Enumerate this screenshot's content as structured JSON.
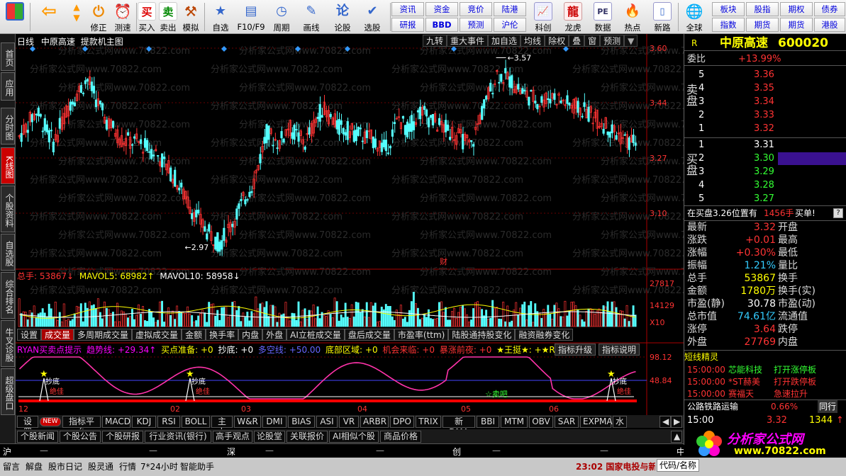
{
  "toolbar": {
    "buttons": [
      {
        "label": "",
        "icon": "grid-icon"
      },
      {
        "label": "",
        "icon": "back-arrow-icon"
      },
      {
        "label": "修正",
        "icon": "up-arrow-icon"
      },
      {
        "label": "测速",
        "icon": "power-icon"
      },
      {
        "label": "",
        "icon": "clock-icon"
      },
      {
        "label": "买入",
        "glyph": "买"
      },
      {
        "label": "卖出",
        "glyph": "卖"
      },
      {
        "label": "模拟",
        "icon": "gavel-icon"
      },
      {
        "label": "自选",
        "icon": "star-folder-icon"
      },
      {
        "label": "F10/F9",
        "icon": "window-icon"
      },
      {
        "label": "周期",
        "icon": "clock-cycle-icon"
      },
      {
        "label": "画线",
        "icon": "pencil-icon"
      },
      {
        "label": "论股",
        "glyph": "论"
      },
      {
        "label": "选股",
        "icon": "check-icon"
      },
      {
        "label": "科创",
        "icon": "chart-icon"
      },
      {
        "label": "龙虎",
        "icon": "dragon-icon"
      },
      {
        "label": "数据",
        "glyph": "PE"
      },
      {
        "label": "热点",
        "icon": "fire-icon"
      },
      {
        "label": "新路",
        "icon": "doc-icon"
      },
      {
        "label": "全球",
        "icon": "globe-icon"
      }
    ],
    "small": [
      "资讯",
      "研报",
      "资金",
      "BBD",
      "竞价",
      "预测",
      "陆港",
      "沪伦",
      "板块",
      "指数",
      "股指",
      "期货",
      "期权",
      "期货",
      "债券",
      "港股"
    ]
  },
  "lefttabs": [
    "首页",
    "应用",
    "分时图",
    "K线图",
    "个股资料",
    "自选股",
    "综合排名",
    "牛叉诊股",
    "超级盘口"
  ],
  "chart": {
    "header": {
      "period": "日线",
      "stock": "中原高速",
      "formula": "提款机主图"
    },
    "tools": [
      "九转",
      "重大事件",
      "加自选",
      "均线",
      "除权",
      "叠",
      "窗",
      "预测"
    ],
    "price_axis": [
      "3.60",
      "3.44",
      "3.27",
      "3.10"
    ],
    "watermark": "分析家公式网www.70822.com",
    "high_label": "3.57",
    "low_label": "2.97",
    "event_label": "财",
    "vol_legend": {
      "total": "总手: 53867↓",
      "ma5": "MAVOL5: 68982↑",
      "ma10": "MAVOL10: 58958↓"
    },
    "vol_axis": [
      "27817",
      "14129",
      "X10"
    ],
    "vol_tabs": [
      "设置",
      "成交量",
      "多周期成交量",
      "虚拟成交量",
      "金额",
      "换手率",
      "内盘",
      "外盘",
      "AI立桩成交量",
      "盘后成交量",
      "市盈率(ttm)",
      "陆股通持股变化",
      "融资融券变化"
    ],
    "ind_legend": {
      "a": "RYAN买卖点提示",
      "b": "趋势线: +29.34↑",
      "c": "买点准备: +0",
      "d": "抄底: +0",
      "e": "多空线: +50.00",
      "f": "底部区域: +0",
      "g": "机会来临: +0",
      "h": "暴涨前夜: +0",
      "i": "★王挺★: +★Ryan★"
    },
    "ind_buttons": [
      "指标升级",
      "指标说明"
    ],
    "ind_axis": [
      "98.12",
      "48.84"
    ],
    "sell_label": "☆卖吧",
    "bottom_labels": [
      "抄底",
      "绝佳",
      "抄底",
      "绝佳",
      "抄底",
      "绝佳"
    ],
    "months": [
      "12",
      "02",
      "03",
      "04",
      "05",
      "06"
    ]
  },
  "indicator_tabs": [
    "设置",
    "NEW",
    "指标平台",
    "MACD",
    "KDJ",
    "RSI",
    "BOLL",
    "主力",
    "W&R",
    "DMI",
    "BIAS",
    "ASI",
    "VR",
    "ARBR",
    "DPO",
    "TRIX",
    "新DMA",
    "BBI",
    "MTM",
    "OBV",
    "SAR",
    "EXPMA",
    "水"
  ],
  "news_tabs": [
    "个股新闻",
    "个股公告",
    "个股研报",
    "行业资讯(银行)",
    "高手观点",
    "论股堂",
    "关联报价",
    "AI相似个股",
    "商品价格"
  ],
  "index_bar": {
    "sh": "沪",
    "sz": "深",
    "cy": "创",
    "zx": "中小",
    "dash": "—"
  },
  "quote": {
    "r": "R",
    "name": "中原高速",
    "code": "600020",
    "weibi_label": "委比",
    "weibi": "+13.99%",
    "sell_label": "卖盘",
    "buy_label": "买盘",
    "asks": [
      {
        "n": "5",
        "p": "3.36"
      },
      {
        "n": "4",
        "p": "3.35"
      },
      {
        "n": "3",
        "p": "3.34"
      },
      {
        "n": "2",
        "p": "3.33"
      },
      {
        "n": "1",
        "p": "3.32"
      }
    ],
    "bids": [
      {
        "n": "1",
        "p": "3.31"
      },
      {
        "n": "2",
        "p": "3.30"
      },
      {
        "n": "3",
        "p": "3.29"
      },
      {
        "n": "4",
        "p": "3.28"
      },
      {
        "n": "5",
        "p": "3.27"
      }
    ],
    "bidinfo": {
      "text": "在买盘3.26位置有",
      "qty": "1456手",
      "tag": "买单!"
    },
    "stats": [
      {
        "l": "最新",
        "v": "3.32",
        "l2": "开盘",
        "v2": ""
      },
      {
        "l": "涨跌",
        "v": "+0.01",
        "l2": "最高",
        "v2": ""
      },
      {
        "l": "涨幅",
        "v": "+0.30%",
        "l2": "最低",
        "v2": ""
      },
      {
        "l": "振幅",
        "v": "1.21%",
        "l2": "量比",
        "v2": ""
      },
      {
        "l": "总手",
        "v": "53867",
        "l2": "换手",
        "v2": ""
      },
      {
        "l": "金额",
        "v": "1780万",
        "l2": "换手(实)",
        "v2": ""
      },
      {
        "l": "市盈(静)",
        "v": "30.78",
        "l2": "市盈(动)",
        "v2": ""
      },
      {
        "l": "总市值",
        "v": "74.61亿",
        "l2": "流通值",
        "v2": ""
      },
      {
        "l": "涨停",
        "v": "3.64",
        "l2": "跌停",
        "v2": ""
      },
      {
        "l": "外盘",
        "v": "27769",
        "l2": "内盘",
        "v2": ""
      }
    ],
    "sprite_title": "短线精灵",
    "sprite": [
      {
        "t": "15:00:00",
        "s": "芯能科技",
        "e": "打开涨停板"
      },
      {
        "t": "15:00:00",
        "s": "*ST赫美",
        "e": "打开跌停板"
      },
      {
        "t": "15:00:00",
        "s": "赛福天",
        "e": "急速拉升"
      }
    ],
    "sector": {
      "name": "公路铁路运输",
      "pct": "0.66%",
      "extra": "同行"
    },
    "last": {
      "t": "15:00",
      "p": "3.32",
      "q": "1344"
    },
    "logo": "分析家公式网",
    "logo_url": "www.70822.com"
  },
  "statusbar": [
    "留言",
    "解盘",
    "股市日记",
    "股灵通",
    "行情",
    "7*24小时",
    "智能助手"
  ],
  "ticker": "23:02 国家电投与新",
  "code_label": "代码/名称"
}
